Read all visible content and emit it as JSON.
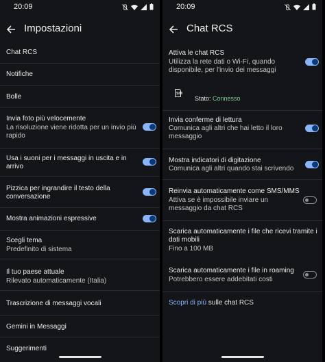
{
  "left": {
    "status": {
      "time": "20:09"
    },
    "header": {
      "title": "Impostazioni"
    },
    "items": [
      {
        "title": "Chat RCS"
      },
      {
        "title": "Notifiche"
      },
      {
        "title": "Bolle"
      },
      {
        "title": "Invia foto più velocemente",
        "subtitle": "La risoluzione viene ridotta per un invio più rapido",
        "subtitle_line1": "La risoluzione viene ridotta per un invio più",
        "subtitle_line2": "rapido",
        "toggle": "on"
      },
      {
        "title_line1": "Usa i suoni per i messaggi in uscita e in",
        "title_line2": "arrivo",
        "toggle": "on"
      },
      {
        "title_line1": "Pizzica per ingrandire il testo della",
        "title_line2": "conversazione",
        "toggle": "on"
      },
      {
        "title": "Mostra animazioni espressive",
        "toggle": "on"
      },
      {
        "title": "Scegli tema",
        "subtitle": "Predefinito di sistema"
      },
      {
        "title": "Il tuo paese attuale",
        "subtitle": "Rilevato automaticamente (Italia)"
      },
      {
        "title": "Trascrizione di messaggi vocali"
      },
      {
        "title": "Gemini in Messaggi"
      },
      {
        "title": "Suggerimenti"
      }
    ]
  },
  "right": {
    "status": {
      "time": "20:09"
    },
    "header": {
      "title": "Chat RCS"
    },
    "enable": {
      "title": "Attiva le chat RCS",
      "line1": "Utilizza la rete dati o Wi-Fi, quando",
      "line2": "disponibile, per l'invio dei messaggi",
      "toggle": "on"
    },
    "sim_label": "SIM",
    "status_label": "Stato:",
    "status_value": "Connesso",
    "read_receipts": {
      "title": "Invia conferme di lettura",
      "line1": "Comunica agli altri che hai letto il loro",
      "line2": "messaggio",
      "toggle": "on"
    },
    "typing": {
      "title": "Mostra indicatori di digitazione",
      "line1": "Comunica agli altri quando stai scrivendo",
      "toggle": "on"
    },
    "resend": {
      "title": "Reinvia automaticamente come SMS/MMS",
      "line1": "Attiva se è impossibile inviare un",
      "line2": "messaggio da chat RCS",
      "toggle": "off"
    },
    "download": {
      "title_line1": "Scarica automaticamente i file che ricevi tramite i",
      "title_line2": "dati mobili",
      "subtitle": "Fino a 100 MB"
    },
    "roaming": {
      "title": "Scarica automaticamente i file in roaming",
      "subtitle": "Potrebbero essere addebitati costi",
      "toggle": "off"
    },
    "learn_more": {
      "link": "Scopri di più",
      "rest": " sulle chat RCS"
    }
  }
}
